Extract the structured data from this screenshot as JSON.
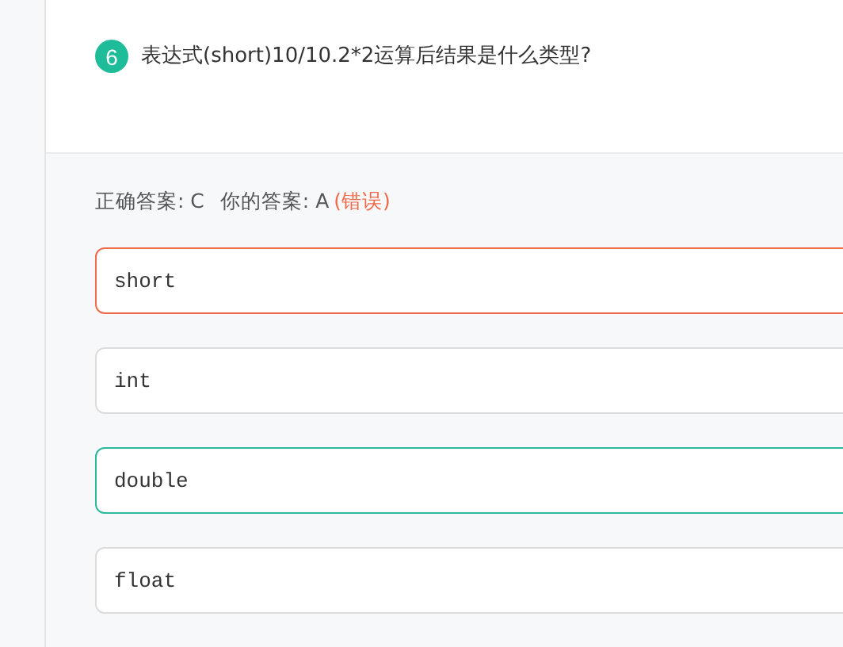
{
  "question": {
    "number": "6",
    "text": "表达式(short)10/10.2*2运算后结果是什么类型?"
  },
  "result": {
    "correct": "正确答案: C",
    "yours": "你的答案: A",
    "verdict": "(错误)"
  },
  "options": [
    {
      "label": "short",
      "selected": true,
      "correct": false
    },
    {
      "label": "int",
      "selected": false,
      "correct": false
    },
    {
      "label": "double",
      "selected": false,
      "correct": true
    },
    {
      "label": "float",
      "selected": false,
      "correct": false
    }
  ]
}
